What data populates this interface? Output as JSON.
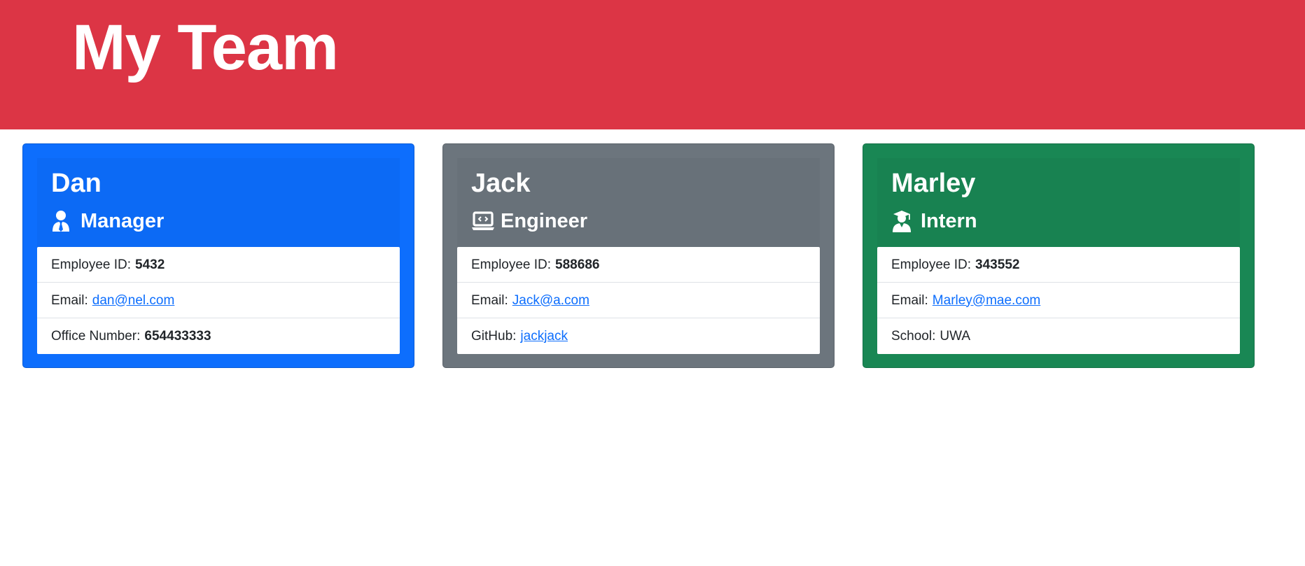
{
  "header": {
    "title": "My Team"
  },
  "colors": {
    "header_bg": "#dc3545",
    "manager_bg": "#0d6efd",
    "engineer_bg": "#6c757d",
    "intern_bg": "#198754",
    "link": "#0d6efd"
  },
  "cards": [
    {
      "name": "Dan",
      "role": "Manager",
      "icon": "user-tie-icon",
      "id_label": "Employee ID:",
      "id_value": "5432",
      "email_label": "Email:",
      "email_value": "dan@nel.com",
      "extra_label": "Office Number:",
      "extra_value": "654433333"
    },
    {
      "name": "Jack",
      "role": "Engineer",
      "icon": "laptop-code-icon",
      "id_label": "Employee ID:",
      "id_value": "588686",
      "email_label": "Email:",
      "email_value": "Jack@a.com",
      "extra_label": "GitHub:",
      "extra_value": "jackjack"
    },
    {
      "name": "Marley",
      "role": "Intern",
      "icon": "user-graduate-icon",
      "id_label": "Employee ID:",
      "id_value": "343552",
      "email_label": "Email:",
      "email_value": "Marley@mae.com",
      "extra_label": "School:",
      "extra_value": "UWA"
    }
  ]
}
